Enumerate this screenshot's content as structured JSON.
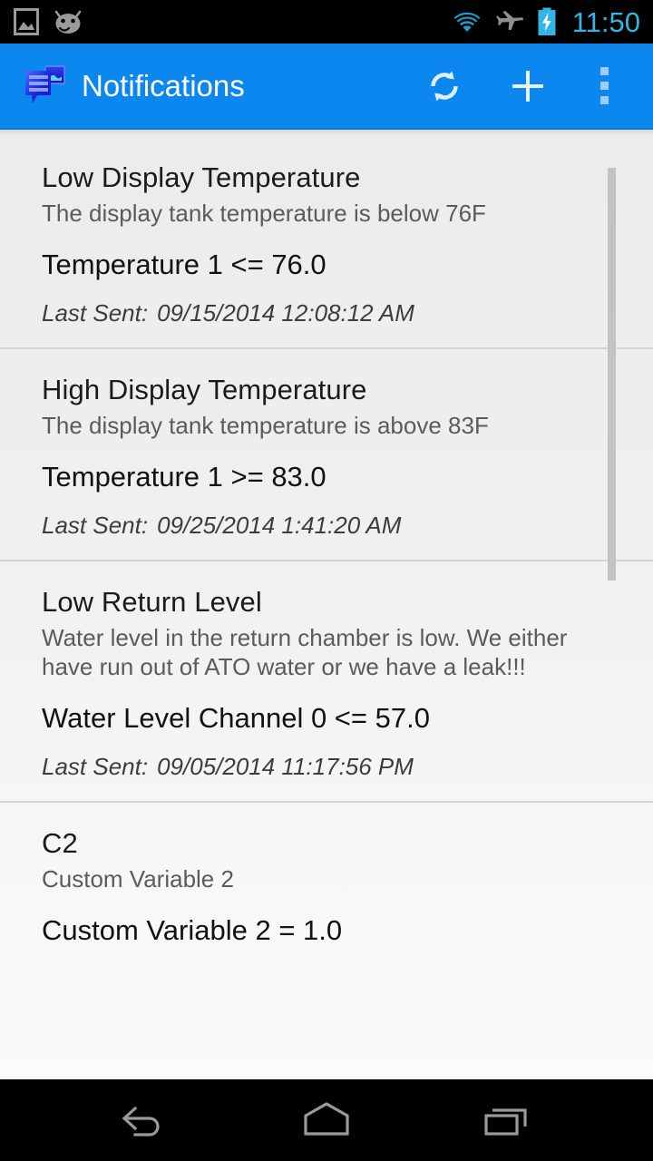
{
  "status_bar": {
    "left_icons": [
      {
        "name": "screenshot-image-icon",
        "label": "screenshot"
      },
      {
        "name": "android-jellybean-icon",
        "label": "android"
      }
    ],
    "right_icons": [
      {
        "name": "wifi-icon",
        "label": "wifi",
        "color": "#1d9ecf"
      },
      {
        "name": "airplane-mode-icon",
        "label": "airplane mode",
        "color": "#8f8f8f"
      },
      {
        "name": "battery-charging-icon",
        "label": "battery charging",
        "color": "#33b5e5"
      }
    ],
    "clock": "11:50",
    "clock_color": "#33b5e5",
    "background": "#000000"
  },
  "action_bar": {
    "app_icon": "notifications-app-icon",
    "title": "Notifications",
    "background": "#0c87f0",
    "title_color": "#ffffff",
    "actions": [
      {
        "name": "refresh-button",
        "icon": "refresh-icon",
        "label": "Refresh"
      },
      {
        "name": "add-button",
        "icon": "plus-icon",
        "label": "Add"
      },
      {
        "name": "overflow-menu-button",
        "icon": "more-vertical-icon",
        "label": "More options"
      }
    ]
  },
  "list": {
    "last_sent_label": "Last Sent:",
    "items": [
      {
        "title": "Low Display Temperature",
        "description": "The display tank temperature is below 76F",
        "condition": "Temperature 1 <= 76.0",
        "last_sent": "09/15/2014 12:08:12 AM"
      },
      {
        "title": "High Display Temperature",
        "description": "The display tank temperature is above 83F",
        "condition": "Temperature 1 >= 83.0",
        "last_sent": "09/25/2014 1:41:20 AM"
      },
      {
        "title": "Low Return Level",
        "description": "Water level in the return chamber is low. We either have run out of ATO water or we have a leak!!!",
        "condition": "Water Level Channel 0 <= 57.0",
        "last_sent": "09/05/2014 11:17:56 PM"
      },
      {
        "title": "C2",
        "description": "Custom Variable 2",
        "condition": "Custom Variable 2 = 1.0",
        "last_sent": ""
      }
    ]
  },
  "scrollbar": {
    "name": "list-scrollbar",
    "color": "#c3c3c3"
  },
  "nav_bar": {
    "background": "#000000",
    "buttons": [
      {
        "name": "nav-back-button",
        "icon": "back-arrow-icon",
        "label": "Back"
      },
      {
        "name": "nav-home-button",
        "icon": "home-icon",
        "label": "Home"
      },
      {
        "name": "nav-recents-button",
        "icon": "recent-apps-icon",
        "label": "Recent apps"
      }
    ]
  }
}
